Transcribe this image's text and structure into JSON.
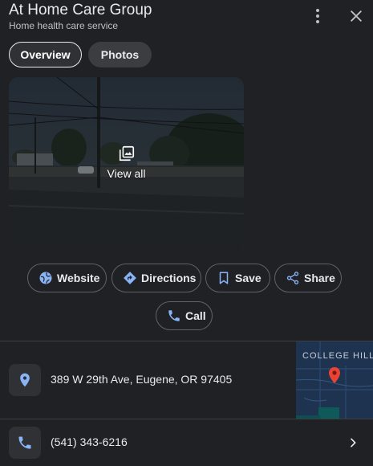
{
  "place": {
    "name": "At Home Care Group",
    "category": "Home health care service"
  },
  "header": {
    "more_icon": "more-vert-icon",
    "close_icon": "close-icon"
  },
  "tabs": [
    {
      "label": "Overview",
      "active": true
    },
    {
      "label": "Photos",
      "active": false
    }
  ],
  "photo": {
    "view_all_label": "View all",
    "icon": "photo-library-icon"
  },
  "actions": [
    {
      "label": "Website",
      "icon": "globe-icon"
    },
    {
      "label": "Directions",
      "icon": "directions-icon"
    },
    {
      "label": "Save",
      "icon": "bookmark-icon"
    },
    {
      "label": "Share",
      "icon": "share-icon"
    },
    {
      "label": "Call",
      "icon": "phone-icon"
    }
  ],
  "info": {
    "address": "389 W 29th Ave, Eugene, OR 97405",
    "address_icon": "location-pin-icon",
    "phone": "(541) 343-6216",
    "phone_icon": "phone-icon"
  },
  "map": {
    "label": "COLLEGE HILL",
    "marker_color": "#ea4335"
  },
  "colors": {
    "background": "#202124",
    "accent": "#8ab4f8",
    "text": "#e8eaed"
  }
}
